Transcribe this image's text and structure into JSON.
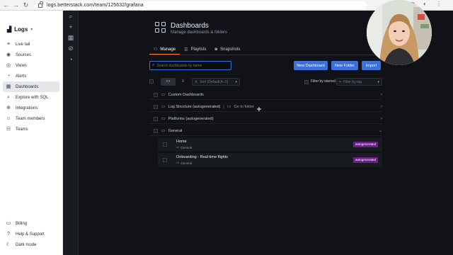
{
  "browser": {
    "url": "logs.betterstack.com/team/125632/grafana",
    "back_icon": "arrow-left-icon",
    "forward_icon": "arrow-right-icon",
    "reload_icon": "reload-icon"
  },
  "app": {
    "brand": "Logs",
    "nav": [
      {
        "label": "Live tail",
        "icon": "list-icon"
      },
      {
        "label": "Sources",
        "icon": "database-icon"
      },
      {
        "label": "Views",
        "icon": "eye-icon"
      },
      {
        "label": "Alerts",
        "icon": "bell-icon"
      },
      {
        "label": "Dashboards",
        "icon": "grid-icon",
        "active": true
      },
      {
        "label": "Explore with SQL",
        "icon": "search-icon"
      },
      {
        "label": "Integrations",
        "icon": "plug-icon"
      },
      {
        "label": "Team members",
        "icon": "users-icon"
      },
      {
        "label": "Teams",
        "icon": "team-icon"
      }
    ],
    "bottom": [
      {
        "label": "Billing",
        "icon": "card-icon"
      },
      {
        "label": "Help & Support",
        "icon": "help-icon"
      },
      {
        "label": "Dark mode",
        "icon": "moon-icon"
      }
    ]
  },
  "grafana": {
    "title": "Dashboards",
    "subtitle": "Manage dashboards & folders",
    "tabs": [
      {
        "label": "Manage",
        "active": true
      },
      {
        "label": "Playlists"
      },
      {
        "label": "Snapshots"
      }
    ],
    "search_placeholder": "Search dashboards by name",
    "buttons": {
      "new_dashboard": "New Dashboard",
      "new_folder": "New Folder",
      "import": "Import"
    },
    "sort_placeholder": "Sort (Default A–Z)",
    "filter_starred": "Filter by starred",
    "filter_tag": "Filter by tag",
    "folders": [
      {
        "label": "Custom Dashboards"
      },
      {
        "label": "Log Structure (autogenerated)",
        "goto": "Go to folder"
      },
      {
        "label": "Platforms (autogenerated)"
      },
      {
        "label": "General",
        "expanded": true
      }
    ],
    "dashboards": [
      {
        "title": "Home",
        "folder": "General",
        "tag": "autogenerated"
      },
      {
        "title": "Onboarding - Real-time flights",
        "folder": "General",
        "tag": "autogenerated"
      }
    ],
    "colors": {
      "primary": "#3d71d9",
      "tag": "#6e1e8a",
      "tab_active": "#ff7a22"
    }
  }
}
